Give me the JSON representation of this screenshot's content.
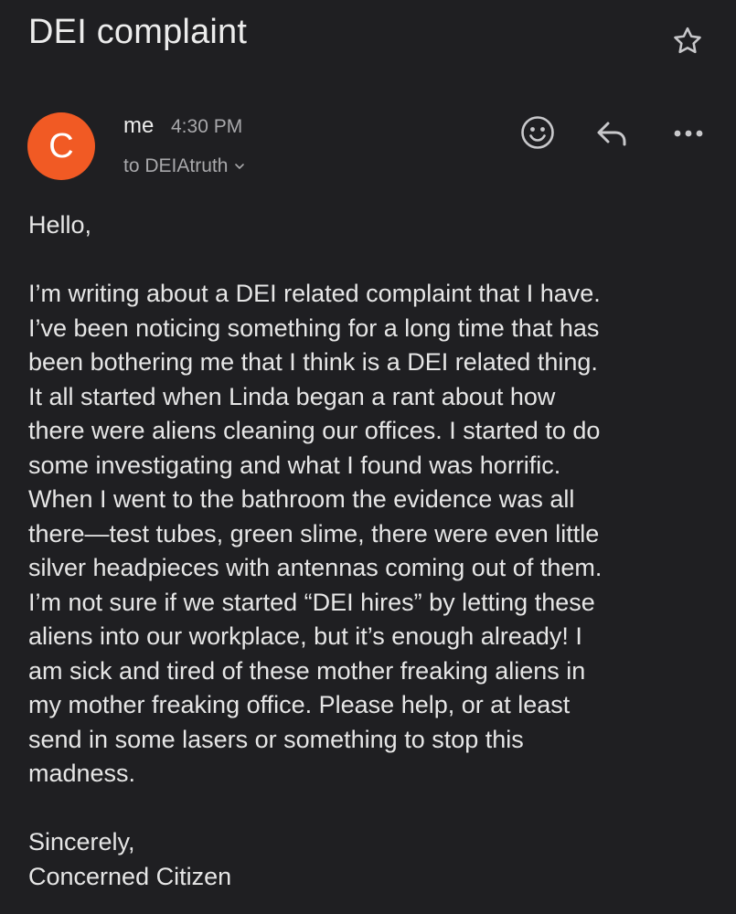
{
  "subject": "DEI complaint",
  "sender": {
    "avatar_letter": "C",
    "avatar_color": "#f15a24",
    "name": "me",
    "time": "4:30 PM",
    "recipient": "to DEIAtruth"
  },
  "actions": {
    "star_icon": "star-outline-icon",
    "react_icon": "smiley-icon",
    "reply_icon": "reply-arrow-icon",
    "more_icon": "more-horizontal-icon"
  },
  "body": {
    "greeting": "Hello,",
    "paragraph_lines": [
      "I’m writing about a DEI related complaint that I have.",
      "I’ve been noticing something for a long time that has",
      "been bothering me that I think is a DEI related thing.",
      "It all started when Linda began a rant about how",
      "there were aliens cleaning our offices. I started to do",
      "some investigating and what I found was horrific.",
      "When I went to the bathroom the evidence was all",
      "there—test tubes, green slime, there were even little",
      "silver headpieces with antennas coming out of them.",
      "I’m not sure if we started “DEI hires” by letting these",
      "aliens into our workplace, but it’s enough already! I",
      "am sick and tired of these mother freaking aliens in",
      "my mother freaking office. Please help, or at least",
      "send in some lasers or something to stop this",
      "madness."
    ],
    "signoff": "Sincerely,",
    "signature": "Concerned Citizen"
  }
}
